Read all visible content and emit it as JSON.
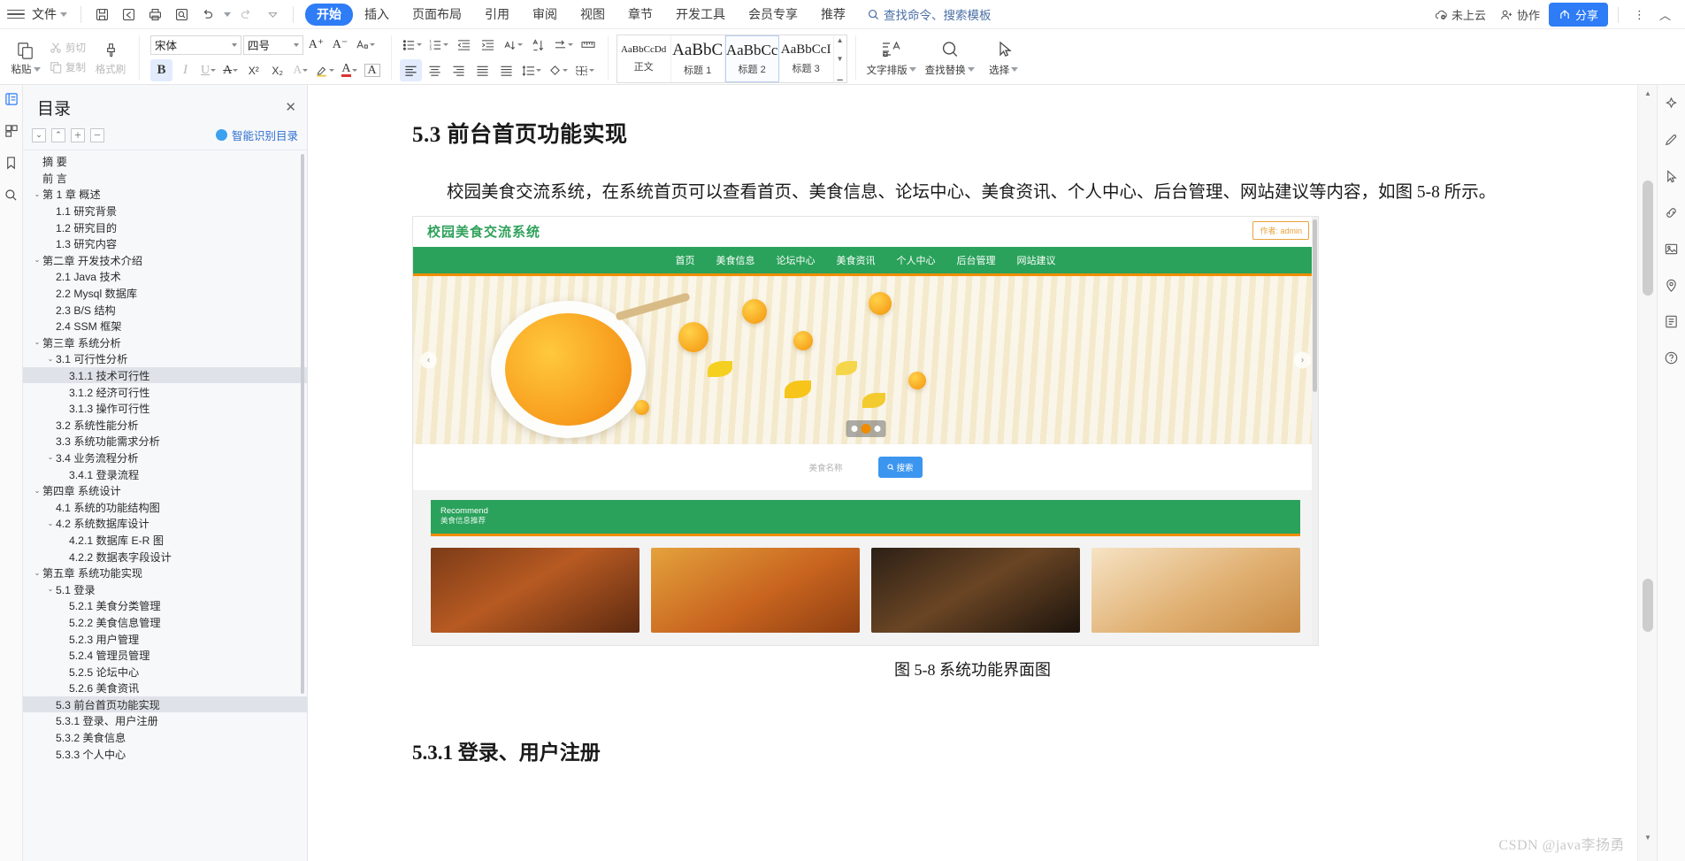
{
  "titlebar": {
    "file_label": "文件",
    "quick_icons": [
      "save-icon",
      "save-as-icon",
      "print-icon",
      "print-preview-icon",
      "undo-icon",
      "redo-icon",
      "customize-icon"
    ],
    "tabs": [
      "开始",
      "插入",
      "页面布局",
      "引用",
      "审阅",
      "视图",
      "章节",
      "开发工具",
      "会员专享",
      "推荐"
    ],
    "active_tab": "开始",
    "search_placeholder": "查找命令、搜索模板",
    "cloud_status": "未上云",
    "collaborate": "协作",
    "share": "分享",
    "more": "⋮",
    "collapse": "︿"
  },
  "ribbon": {
    "paste": "粘贴",
    "cut": "剪切",
    "copy": "复制",
    "format_painter": "格式刷",
    "font_name": "宋体",
    "font_size": "四号",
    "grow_font": "A⁺",
    "shrink_font": "A⁻",
    "change_case": "变",
    "bold": "B",
    "italic": "I",
    "underline": "U",
    "strikethrough": "A",
    "superscript": "X²",
    "subscript": "X₂",
    "text_effect": "A",
    "highlight": "✎",
    "font_color": "A",
    "clear_format": "A",
    "styles": [
      {
        "preview": "AaBbCcDd",
        "name": "正文",
        "selected": false
      },
      {
        "preview": "AaBbC",
        "name": "标题 1",
        "selected": false
      },
      {
        "preview": "AaBbCc",
        "name": "标题 2",
        "selected": true
      },
      {
        "preview": "AaBbCcI",
        "name": "标题 3",
        "selected": false
      }
    ],
    "text_layout": "文字排版",
    "find_replace": "查找替换",
    "select": "选择"
  },
  "toc": {
    "title": "目录",
    "close": "✕",
    "tools": [
      "collapse-down",
      "collapse-up",
      "expand-all",
      "collapse-all"
    ],
    "ai_label": "智能识别目录",
    "items": [
      {
        "label": "摘  要",
        "indent": 0,
        "chev": ""
      },
      {
        "label": "前  言",
        "indent": 0,
        "chev": ""
      },
      {
        "label": "第 1 章 概述",
        "indent": 0,
        "chev": "⌄"
      },
      {
        "label": "1.1 研究背景",
        "indent": 1,
        "chev": ""
      },
      {
        "label": "1.2 研究目的",
        "indent": 1,
        "chev": ""
      },
      {
        "label": "1.3 研究内容",
        "indent": 1,
        "chev": ""
      },
      {
        "label": "第二章 开发技术介绍",
        "indent": 0,
        "chev": "⌄"
      },
      {
        "label": "2.1 Java 技术",
        "indent": 1,
        "chev": ""
      },
      {
        "label": "2.2 Mysql 数据库",
        "indent": 1,
        "chev": ""
      },
      {
        "label": "2.3 B/S 结构",
        "indent": 1,
        "chev": ""
      },
      {
        "label": "2.4 SSM 框架",
        "indent": 1,
        "chev": ""
      },
      {
        "label": "第三章 系统分析",
        "indent": 0,
        "chev": "⌄"
      },
      {
        "label": "3.1 可行性分析",
        "indent": 1,
        "chev": "⌄"
      },
      {
        "label": "3.1.1   技术可行性",
        "indent": 2,
        "chev": "",
        "hover": true
      },
      {
        "label": "3.1.2 经济可行性",
        "indent": 2,
        "chev": ""
      },
      {
        "label": "3.1.3 操作可行性",
        "indent": 2,
        "chev": ""
      },
      {
        "label": "3.2 系统性能分析",
        "indent": 1,
        "chev": ""
      },
      {
        "label": "3.3 系统功能需求分析",
        "indent": 1,
        "chev": ""
      },
      {
        "label": "3.4 业务流程分析",
        "indent": 1,
        "chev": "⌄"
      },
      {
        "label": "3.4.1 登录流程",
        "indent": 2,
        "chev": ""
      },
      {
        "label": "第四章 系统设计",
        "indent": 0,
        "chev": "⌄"
      },
      {
        "label": "4.1 系统的功能结构图",
        "indent": 1,
        "chev": ""
      },
      {
        "label": "4.2 系统数据库设计",
        "indent": 1,
        "chev": "⌄"
      },
      {
        "label": "4.2.1   数据库 E-R 图",
        "indent": 2,
        "chev": ""
      },
      {
        "label": "4.2.2   数据表字段设计",
        "indent": 2,
        "chev": ""
      },
      {
        "label": "第五章 系统功能实现",
        "indent": 0,
        "chev": "⌄"
      },
      {
        "label": "5.1 登录",
        "indent": 1,
        "chev": "⌄"
      },
      {
        "label": "5.2.1 美食分类管理",
        "indent": 2,
        "chev": ""
      },
      {
        "label": "5.2.2 美食信息管理",
        "indent": 2,
        "chev": ""
      },
      {
        "label": "5.2.3 用户管理",
        "indent": 2,
        "chev": ""
      },
      {
        "label": "5.2.4 管理员管理",
        "indent": 2,
        "chev": ""
      },
      {
        "label": "5.2.5 论坛中心",
        "indent": 2,
        "chev": ""
      },
      {
        "label": "5.2.6 美食资讯",
        "indent": 2,
        "chev": ""
      },
      {
        "label": "5.3 前台首页功能实现",
        "indent": 1,
        "chev": "",
        "selected": true
      },
      {
        "label": "5.3.1 登录、用户注册",
        "indent": 1,
        "chev": ""
      },
      {
        "label": "5.3.2 美食信息",
        "indent": 1,
        "chev": ""
      },
      {
        "label": "5.3.3 个人中心",
        "indent": 1,
        "chev": ""
      }
    ]
  },
  "document": {
    "heading": "5.3 前台首页功能实现",
    "paragraph": "校园美食交流系统，在系统首页可以查看首页、美食信息、论坛中心、美食资讯、个人中心、后台管理、网站建议等内容，如图 5-8 所示。",
    "figure_caption": "图 5-8 系统功能界面图",
    "subheading": "5.3.1 登录、用户注册",
    "watermark": "CSDN @java李扬勇"
  },
  "screenshot": {
    "site_title": "校园美食交流系统",
    "user_badge": "作者: admin",
    "nav": [
      "首页",
      "美食信息",
      "论坛中心",
      "美食资讯",
      "个人中心",
      "后台管理",
      "网站建议"
    ],
    "search_placeholder": "美食名称",
    "search_button": "搜索",
    "recommend_en": "Recommend",
    "recommend_cn": "美食信息推荐",
    "prev_arrow": "‹",
    "next_arrow": "›"
  },
  "colors": {
    "accent_blue": "#2e7cf6",
    "site_green": "#2aa25b",
    "site_orange": "#f08c00",
    "search_blue": "#3c96f0",
    "badge_orange": "#e8a33d"
  }
}
